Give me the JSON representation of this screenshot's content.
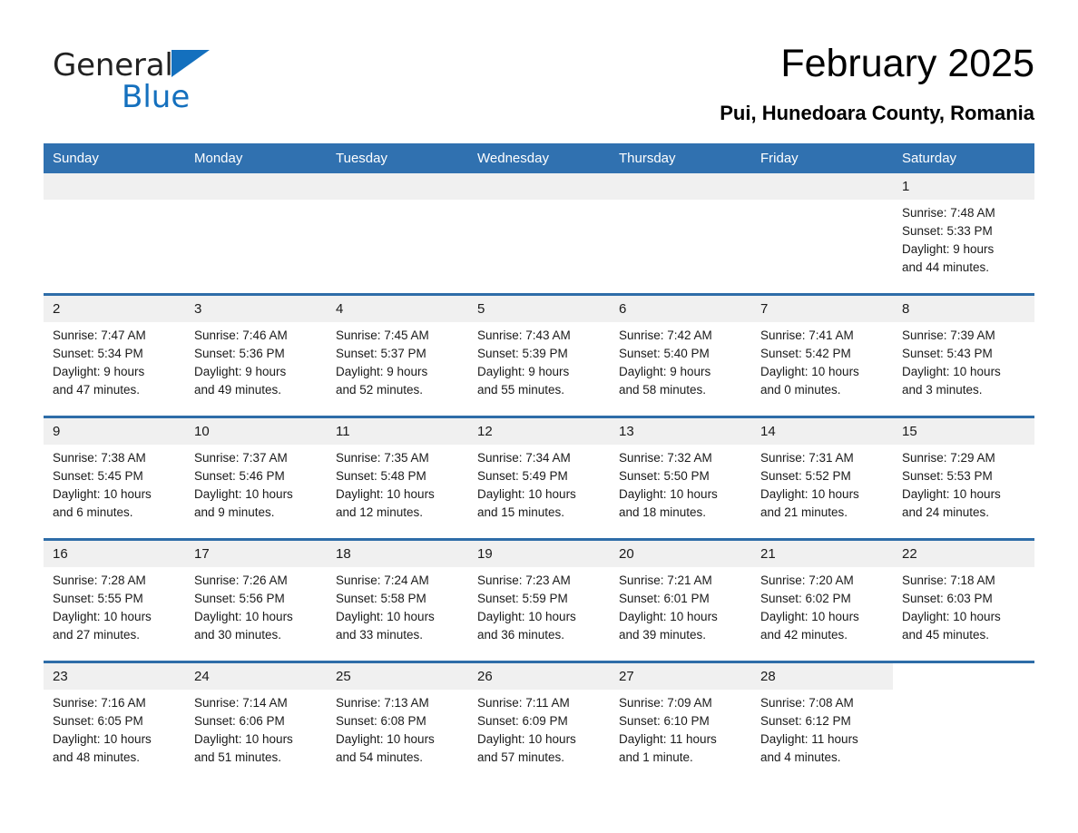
{
  "brand": {
    "name_part1": "General",
    "name_part2": "Blue",
    "logo_icon": "triangle-logo-icon",
    "accent_color": "#1470BE"
  },
  "header": {
    "title": "February 2025",
    "location": "Pui, Hunedoara County, Romania"
  },
  "theme": {
    "header_blue": "#3071B0",
    "separator_blue": "#2E6DA8",
    "daynum_band": "#F0F0F0"
  },
  "weekdays": [
    "Sunday",
    "Monday",
    "Tuesday",
    "Wednesday",
    "Thursday",
    "Friday",
    "Saturday"
  ],
  "weeks": [
    [
      {
        "day": "",
        "empty": true
      },
      {
        "day": "",
        "empty": true
      },
      {
        "day": "",
        "empty": true
      },
      {
        "day": "",
        "empty": true
      },
      {
        "day": "",
        "empty": true
      },
      {
        "day": "",
        "empty": true
      },
      {
        "day": "1",
        "sunrise": "Sunrise: 7:48 AM",
        "sunset": "Sunset: 5:33 PM",
        "daylight_line1": "Daylight: 9 hours",
        "daylight_line2": "and 44 minutes."
      }
    ],
    [
      {
        "day": "2",
        "sunrise": "Sunrise: 7:47 AM",
        "sunset": "Sunset: 5:34 PM",
        "daylight_line1": "Daylight: 9 hours",
        "daylight_line2": "and 47 minutes."
      },
      {
        "day": "3",
        "sunrise": "Sunrise: 7:46 AM",
        "sunset": "Sunset: 5:36 PM",
        "daylight_line1": "Daylight: 9 hours",
        "daylight_line2": "and 49 minutes."
      },
      {
        "day": "4",
        "sunrise": "Sunrise: 7:45 AM",
        "sunset": "Sunset: 5:37 PM",
        "daylight_line1": "Daylight: 9 hours",
        "daylight_line2": "and 52 minutes."
      },
      {
        "day": "5",
        "sunrise": "Sunrise: 7:43 AM",
        "sunset": "Sunset: 5:39 PM",
        "daylight_line1": "Daylight: 9 hours",
        "daylight_line2": "and 55 minutes."
      },
      {
        "day": "6",
        "sunrise": "Sunrise: 7:42 AM",
        "sunset": "Sunset: 5:40 PM",
        "daylight_line1": "Daylight: 9 hours",
        "daylight_line2": "and 58 minutes."
      },
      {
        "day": "7",
        "sunrise": "Sunrise: 7:41 AM",
        "sunset": "Sunset: 5:42 PM",
        "daylight_line1": "Daylight: 10 hours",
        "daylight_line2": "and 0 minutes."
      },
      {
        "day": "8",
        "sunrise": "Sunrise: 7:39 AM",
        "sunset": "Sunset: 5:43 PM",
        "daylight_line1": "Daylight: 10 hours",
        "daylight_line2": "and 3 minutes."
      }
    ],
    [
      {
        "day": "9",
        "sunrise": "Sunrise: 7:38 AM",
        "sunset": "Sunset: 5:45 PM",
        "daylight_line1": "Daylight: 10 hours",
        "daylight_line2": "and 6 minutes."
      },
      {
        "day": "10",
        "sunrise": "Sunrise: 7:37 AM",
        "sunset": "Sunset: 5:46 PM",
        "daylight_line1": "Daylight: 10 hours",
        "daylight_line2": "and 9 minutes."
      },
      {
        "day": "11",
        "sunrise": "Sunrise: 7:35 AM",
        "sunset": "Sunset: 5:48 PM",
        "daylight_line1": "Daylight: 10 hours",
        "daylight_line2": "and 12 minutes."
      },
      {
        "day": "12",
        "sunrise": "Sunrise: 7:34 AM",
        "sunset": "Sunset: 5:49 PM",
        "daylight_line1": "Daylight: 10 hours",
        "daylight_line2": "and 15 minutes."
      },
      {
        "day": "13",
        "sunrise": "Sunrise: 7:32 AM",
        "sunset": "Sunset: 5:50 PM",
        "daylight_line1": "Daylight: 10 hours",
        "daylight_line2": "and 18 minutes."
      },
      {
        "day": "14",
        "sunrise": "Sunrise: 7:31 AM",
        "sunset": "Sunset: 5:52 PM",
        "daylight_line1": "Daylight: 10 hours",
        "daylight_line2": "and 21 minutes."
      },
      {
        "day": "15",
        "sunrise": "Sunrise: 7:29 AM",
        "sunset": "Sunset: 5:53 PM",
        "daylight_line1": "Daylight: 10 hours",
        "daylight_line2": "and 24 minutes."
      }
    ],
    [
      {
        "day": "16",
        "sunrise": "Sunrise: 7:28 AM",
        "sunset": "Sunset: 5:55 PM",
        "daylight_line1": "Daylight: 10 hours",
        "daylight_line2": "and 27 minutes."
      },
      {
        "day": "17",
        "sunrise": "Sunrise: 7:26 AM",
        "sunset": "Sunset: 5:56 PM",
        "daylight_line1": "Daylight: 10 hours",
        "daylight_line2": "and 30 minutes."
      },
      {
        "day": "18",
        "sunrise": "Sunrise: 7:24 AM",
        "sunset": "Sunset: 5:58 PM",
        "daylight_line1": "Daylight: 10 hours",
        "daylight_line2": "and 33 minutes."
      },
      {
        "day": "19",
        "sunrise": "Sunrise: 7:23 AM",
        "sunset": "Sunset: 5:59 PM",
        "daylight_line1": "Daylight: 10 hours",
        "daylight_line2": "and 36 minutes."
      },
      {
        "day": "20",
        "sunrise": "Sunrise: 7:21 AM",
        "sunset": "Sunset: 6:01 PM",
        "daylight_line1": "Daylight: 10 hours",
        "daylight_line2": "and 39 minutes."
      },
      {
        "day": "21",
        "sunrise": "Sunrise: 7:20 AM",
        "sunset": "Sunset: 6:02 PM",
        "daylight_line1": "Daylight: 10 hours",
        "daylight_line2": "and 42 minutes."
      },
      {
        "day": "22",
        "sunrise": "Sunrise: 7:18 AM",
        "sunset": "Sunset: 6:03 PM",
        "daylight_line1": "Daylight: 10 hours",
        "daylight_line2": "and 45 minutes."
      }
    ],
    [
      {
        "day": "23",
        "sunrise": "Sunrise: 7:16 AM",
        "sunset": "Sunset: 6:05 PM",
        "daylight_line1": "Daylight: 10 hours",
        "daylight_line2": "and 48 minutes."
      },
      {
        "day": "24",
        "sunrise": "Sunrise: 7:14 AM",
        "sunset": "Sunset: 6:06 PM",
        "daylight_line1": "Daylight: 10 hours",
        "daylight_line2": "and 51 minutes."
      },
      {
        "day": "25",
        "sunrise": "Sunrise: 7:13 AM",
        "sunset": "Sunset: 6:08 PM",
        "daylight_line1": "Daylight: 10 hours",
        "daylight_line2": "and 54 minutes."
      },
      {
        "day": "26",
        "sunrise": "Sunrise: 7:11 AM",
        "sunset": "Sunset: 6:09 PM",
        "daylight_line1": "Daylight: 10 hours",
        "daylight_line2": "and 57 minutes."
      },
      {
        "day": "27",
        "sunrise": "Sunrise: 7:09 AM",
        "sunset": "Sunset: 6:10 PM",
        "daylight_line1": "Daylight: 11 hours",
        "daylight_line2": "and 1 minute."
      },
      {
        "day": "28",
        "sunrise": "Sunrise: 7:08 AM",
        "sunset": "Sunset: 6:12 PM",
        "daylight_line1": "Daylight: 11 hours",
        "daylight_line2": "and 4 minutes."
      },
      {
        "day": "",
        "empty": true
      }
    ]
  ]
}
